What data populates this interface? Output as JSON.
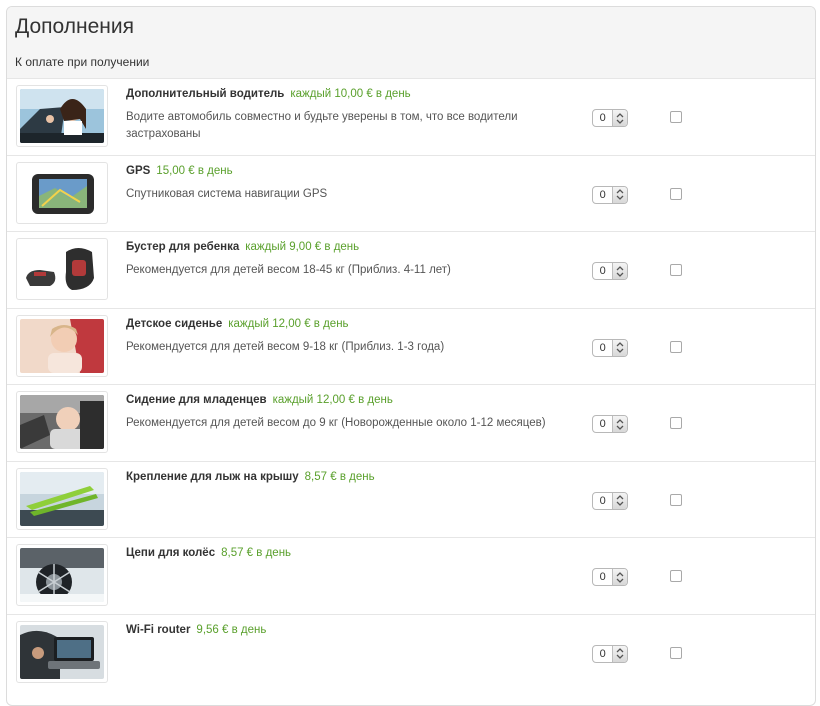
{
  "panel": {
    "title": "Дополнения",
    "payment_label": "К оплате при получении"
  },
  "items": [
    {
      "name": "Дополнительный водитель",
      "price": "каждый 10,00 € в день",
      "description": "Водите автомобиль совместно и будьте уверены в том, что все водители застрахованы",
      "quantity": "0",
      "checked": false,
      "image": "additional-driver-photo"
    },
    {
      "name": "GPS",
      "price": "15,00 € в день",
      "description": "Спутниковая система навигации GPS",
      "quantity": "0",
      "checked": false,
      "image": "gps-navigator-photo"
    },
    {
      "name": "Бустер для ребенка",
      "price": "каждый 9,00 € в день",
      "description": "Рекомендуется для детей весом 18-45 кг (Приблиз. 4-11 лет)",
      "quantity": "0",
      "checked": false,
      "image": "booster-seat-photo"
    },
    {
      "name": "Детское сиденье",
      "price": "каждый 12,00 € в день",
      "description": "Рекомендуется для детей весом 9-18 кг (Приблиз. 1-3 года)",
      "quantity": "0",
      "checked": false,
      "image": "child-seat-photo"
    },
    {
      "name": "Сидение для младенцев",
      "price": "каждый 12,00 € в день",
      "description": "Рекомендуется для детей весом до 9 кг (Новорожденные около 1-12 месяцев)",
      "quantity": "0",
      "checked": false,
      "image": "infant-seat-photo"
    },
    {
      "name": "Крепление для лыж на крышу",
      "price": "8,57 € в день",
      "description": "",
      "quantity": "0",
      "checked": false,
      "image": "ski-rack-photo"
    },
    {
      "name": "Цепи для колёс",
      "price": "8,57 € в день",
      "description": "",
      "quantity": "0",
      "checked": false,
      "image": "snow-chains-photo"
    },
    {
      "name": "Wi-Fi router",
      "price": "9,56 € в день",
      "description": "",
      "quantity": "0",
      "checked": false,
      "image": "wifi-router-photo"
    }
  ],
  "colors": {
    "price": "#5aa02c",
    "header_bg": "#f5f5f5",
    "border": "#e6e6e6"
  }
}
